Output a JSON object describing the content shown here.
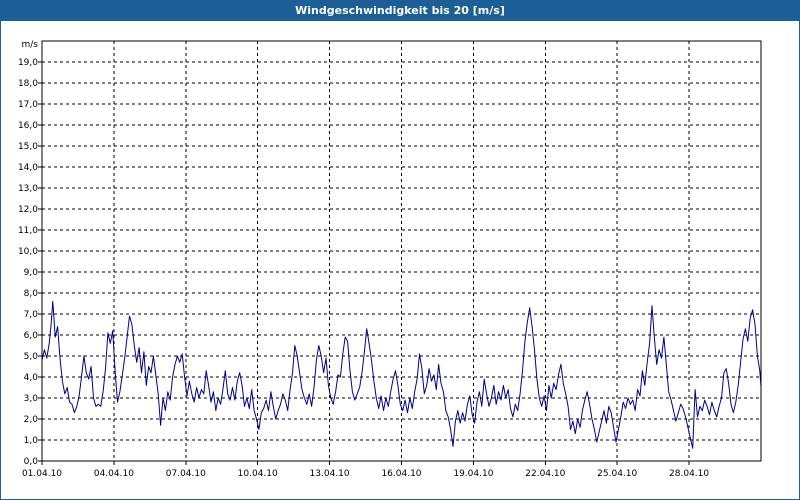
{
  "window": {
    "title": "Windgeschwindigkeit bis 20 [m/s]"
  },
  "colors": {
    "titlebar": "#1c5e96",
    "series": "#00008b",
    "grid": "#000000"
  },
  "chart_data": {
    "type": "line",
    "title": "Windgeschwindigkeit bis 20 [m/s]",
    "ylabel": "m/s",
    "ylim": [
      0,
      20
    ],
    "y_ticks": [
      "0,0",
      "1,0",
      "2,0",
      "3,0",
      "4,0",
      "5,0",
      "6,0",
      "7,0",
      "8,0",
      "9,0",
      "10,0",
      "11,0",
      "12,0",
      "13,0",
      "14,0",
      "15,0",
      "16,0",
      "17,0",
      "18,0",
      "19,0"
    ],
    "x_ticks": [
      "01.04.10",
      "04.04.10",
      "07.04.10",
      "10.04.10",
      "13.04.10",
      "16.04.10",
      "19.04.10",
      "22.04.10",
      "25.04.10",
      "28.04.10"
    ],
    "x_range": [
      "01.04.10 00:00",
      "01.05.10 00:00"
    ],
    "grid": true,
    "series": [
      {
        "x_unit": "days after 01.04.10 00:00",
        "values": [
          [
            0.0,
            4.8
          ],
          [
            0.1,
            5.3
          ],
          [
            0.2,
            4.9
          ],
          [
            0.3,
            5.6
          ],
          [
            0.38,
            6.5
          ],
          [
            0.45,
            7.6
          ],
          [
            0.55,
            5.9
          ],
          [
            0.65,
            6.4
          ],
          [
            0.75,
            4.9
          ],
          [
            0.85,
            3.8
          ],
          [
            0.95,
            3.2
          ],
          [
            1.05,
            3.5
          ],
          [
            1.15,
            2.8
          ],
          [
            1.25,
            2.7
          ],
          [
            1.35,
            2.3
          ],
          [
            1.45,
            2.6
          ],
          [
            1.55,
            3.1
          ],
          [
            1.65,
            4.0
          ],
          [
            1.75,
            5.0
          ],
          [
            1.85,
            4.2
          ],
          [
            1.95,
            3.9
          ],
          [
            2.05,
            4.5
          ],
          [
            2.15,
            3.0
          ],
          [
            2.25,
            2.6
          ],
          [
            2.35,
            2.7
          ],
          [
            2.45,
            2.6
          ],
          [
            2.55,
            3.3
          ],
          [
            2.65,
            4.4
          ],
          [
            2.75,
            6.1
          ],
          [
            2.85,
            5.6
          ],
          [
            2.95,
            6.2
          ],
          [
            3.05,
            4.3
          ],
          [
            3.15,
            2.8
          ],
          [
            3.25,
            3.3
          ],
          [
            3.35,
            4.1
          ],
          [
            3.45,
            4.9
          ],
          [
            3.55,
            5.9
          ],
          [
            3.65,
            6.9
          ],
          [
            3.75,
            6.5
          ],
          [
            3.85,
            5.5
          ],
          [
            3.95,
            4.7
          ],
          [
            4.05,
            5.4
          ],
          [
            4.15,
            4.2
          ],
          [
            4.25,
            5.2
          ],
          [
            4.35,
            3.6
          ],
          [
            4.45,
            4.5
          ],
          [
            4.55,
            4.2
          ],
          [
            4.65,
            5.0
          ],
          [
            4.75,
            4.1
          ],
          [
            4.85,
            3.2
          ],
          [
            4.95,
            1.7
          ],
          [
            5.05,
            3.0
          ],
          [
            5.15,
            2.4
          ],
          [
            5.25,
            3.3
          ],
          [
            5.35,
            2.9
          ],
          [
            5.45,
            4.0
          ],
          [
            5.55,
            4.6
          ],
          [
            5.65,
            5.0
          ],
          [
            5.75,
            4.7
          ],
          [
            5.85,
            5.1
          ],
          [
            5.95,
            4.0
          ],
          [
            6.05,
            3.1
          ],
          [
            6.15,
            3.8
          ],
          [
            6.25,
            3.2
          ],
          [
            6.35,
            2.8
          ],
          [
            6.45,
            3.5
          ],
          [
            6.55,
            3.0
          ],
          [
            6.65,
            3.4
          ],
          [
            6.75,
            3.2
          ],
          [
            6.85,
            4.3
          ],
          [
            6.95,
            3.6
          ],
          [
            7.05,
            2.8
          ],
          [
            7.15,
            3.3
          ],
          [
            7.25,
            2.4
          ],
          [
            7.35,
            3.0
          ],
          [
            7.45,
            2.7
          ],
          [
            7.55,
            3.4
          ],
          [
            7.65,
            4.3
          ],
          [
            7.75,
            3.2
          ],
          [
            7.85,
            2.9
          ],
          [
            7.95,
            3.5
          ],
          [
            8.05,
            2.9
          ],
          [
            8.15,
            3.8
          ],
          [
            8.25,
            4.2
          ],
          [
            8.35,
            3.6
          ],
          [
            8.45,
            2.6
          ],
          [
            8.55,
            3.0
          ],
          [
            8.65,
            2.5
          ],
          [
            8.75,
            3.4
          ],
          [
            8.85,
            2.4
          ],
          [
            8.95,
            2.0
          ],
          [
            9.05,
            1.5
          ],
          [
            9.15,
            2.3
          ],
          [
            9.25,
            2.5
          ],
          [
            9.35,
            2.9
          ],
          [
            9.45,
            2.4
          ],
          [
            9.55,
            3.3
          ],
          [
            9.65,
            2.6
          ],
          [
            9.75,
            2.0
          ],
          [
            9.85,
            2.4
          ],
          [
            9.95,
            2.7
          ],
          [
            10.05,
            3.2
          ],
          [
            10.15,
            2.9
          ],
          [
            10.25,
            2.4
          ],
          [
            10.35,
            3.4
          ],
          [
            10.45,
            4.2
          ],
          [
            10.55,
            5.5
          ],
          [
            10.65,
            5.0
          ],
          [
            10.75,
            4.2
          ],
          [
            10.85,
            3.4
          ],
          [
            10.95,
            3.0
          ],
          [
            11.05,
            2.7
          ],
          [
            11.15,
            3.2
          ],
          [
            11.25,
            2.6
          ],
          [
            11.35,
            3.5
          ],
          [
            11.45,
            4.8
          ],
          [
            11.55,
            5.5
          ],
          [
            11.65,
            5.0
          ],
          [
            11.75,
            4.2
          ],
          [
            11.85,
            4.9
          ],
          [
            11.95,
            3.6
          ],
          [
            12.05,
            3.0
          ],
          [
            12.15,
            2.7
          ],
          [
            12.25,
            3.3
          ],
          [
            12.35,
            4.1
          ],
          [
            12.45,
            4.0
          ],
          [
            12.55,
            5.1
          ],
          [
            12.65,
            5.9
          ],
          [
            12.75,
            5.7
          ],
          [
            12.85,
            4.3
          ],
          [
            12.95,
            3.3
          ],
          [
            13.05,
            2.9
          ],
          [
            13.15,
            3.2
          ],
          [
            13.25,
            3.5
          ],
          [
            13.35,
            4.2
          ],
          [
            13.45,
            5.2
          ],
          [
            13.55,
            6.3
          ],
          [
            13.65,
            5.6
          ],
          [
            13.75,
            4.8
          ],
          [
            13.85,
            3.8
          ],
          [
            13.95,
            3.0
          ],
          [
            14.05,
            2.5
          ],
          [
            14.15,
            3.1
          ],
          [
            14.25,
            2.4
          ],
          [
            14.35,
            3.0
          ],
          [
            14.45,
            2.6
          ],
          [
            14.55,
            3.3
          ],
          [
            14.65,
            3.9
          ],
          [
            14.75,
            4.3
          ],
          [
            14.85,
            3.6
          ],
          [
            14.95,
            2.7
          ],
          [
            15.05,
            2.4
          ],
          [
            15.15,
            2.9
          ],
          [
            15.25,
            2.3
          ],
          [
            15.35,
            3.0
          ],
          [
            15.45,
            2.5
          ],
          [
            15.55,
            3.3
          ],
          [
            15.65,
            3.9
          ],
          [
            15.75,
            5.1
          ],
          [
            15.85,
            4.4
          ],
          [
            15.95,
            3.2
          ],
          [
            16.05,
            3.6
          ],
          [
            16.15,
            4.4
          ],
          [
            16.25,
            3.8
          ],
          [
            16.35,
            4.1
          ],
          [
            16.45,
            3.4
          ],
          [
            16.55,
            4.6
          ],
          [
            16.65,
            3.7
          ],
          [
            16.75,
            3.3
          ],
          [
            16.85,
            2.4
          ],
          [
            16.95,
            2.1
          ],
          [
            17.05,
            1.5
          ],
          [
            17.15,
            0.7
          ],
          [
            17.25,
            1.9
          ],
          [
            17.35,
            2.4
          ],
          [
            17.45,
            1.8
          ],
          [
            17.55,
            2.3
          ],
          [
            17.65,
            1.9
          ],
          [
            17.75,
            2.7
          ],
          [
            17.85,
            3.1
          ],
          [
            17.95,
            2.2
          ],
          [
            18.05,
            1.8
          ],
          [
            18.15,
            2.8
          ],
          [
            18.25,
            3.3
          ],
          [
            18.35,
            2.6
          ],
          [
            18.45,
            3.9
          ],
          [
            18.55,
            3.2
          ],
          [
            18.65,
            2.6
          ],
          [
            18.75,
            3.0
          ],
          [
            18.85,
            3.6
          ],
          [
            18.95,
            2.7
          ],
          [
            19.05,
            3.3
          ],
          [
            19.15,
            2.9
          ],
          [
            19.25,
            3.6
          ],
          [
            19.35,
            3.0
          ],
          [
            19.45,
            3.4
          ],
          [
            19.55,
            2.5
          ],
          [
            19.65,
            2.1
          ],
          [
            19.75,
            2.7
          ],
          [
            19.85,
            2.4
          ],
          [
            19.95,
            3.2
          ],
          [
            20.05,
            4.3
          ],
          [
            20.15,
            5.7
          ],
          [
            20.25,
            6.6
          ],
          [
            20.35,
            7.3
          ],
          [
            20.45,
            6.4
          ],
          [
            20.55,
            5.3
          ],
          [
            20.65,
            3.9
          ],
          [
            20.75,
            3.0
          ],
          [
            20.85,
            2.6
          ],
          [
            20.95,
            3.1
          ],
          [
            21.05,
            2.4
          ],
          [
            21.15,
            3.6
          ],
          [
            21.25,
            3.0
          ],
          [
            21.35,
            3.7
          ],
          [
            21.45,
            3.4
          ],
          [
            21.55,
            4.1
          ],
          [
            21.65,
            4.6
          ],
          [
            21.75,
            3.7
          ],
          [
            21.85,
            3.2
          ],
          [
            21.95,
            2.6
          ],
          [
            22.05,
            1.5
          ],
          [
            22.15,
            1.9
          ],
          [
            22.25,
            1.3
          ],
          [
            22.35,
            2.0
          ],
          [
            22.45,
            1.6
          ],
          [
            22.55,
            2.4
          ],
          [
            22.65,
            2.9
          ],
          [
            22.75,
            3.3
          ],
          [
            22.85,
            2.7
          ],
          [
            22.95,
            2.0
          ],
          [
            23.05,
            1.5
          ],
          [
            23.15,
            0.9
          ],
          [
            23.25,
            1.4
          ],
          [
            23.35,
            1.9
          ],
          [
            23.45,
            2.4
          ],
          [
            23.55,
            1.8
          ],
          [
            23.65,
            2.6
          ],
          [
            23.75,
            2.3
          ],
          [
            23.85,
            1.6
          ],
          [
            23.95,
            0.9
          ],
          [
            24.05,
            1.5
          ],
          [
            24.15,
            2.1
          ],
          [
            24.25,
            2.8
          ],
          [
            24.35,
            2.5
          ],
          [
            24.45,
            3.0
          ],
          [
            24.55,
            2.7
          ],
          [
            24.65,
            2.9
          ],
          [
            24.75,
            2.4
          ],
          [
            24.85,
            3.4
          ],
          [
            24.95,
            3.1
          ],
          [
            25.05,
            4.3
          ],
          [
            25.15,
            3.6
          ],
          [
            25.25,
            4.7
          ],
          [
            25.35,
            5.6
          ],
          [
            25.45,
            7.4
          ],
          [
            25.55,
            5.9
          ],
          [
            25.65,
            4.6
          ],
          [
            25.75,
            5.3
          ],
          [
            25.85,
            4.9
          ],
          [
            25.95,
            5.9
          ],
          [
            26.05,
            4.6
          ],
          [
            26.15,
            3.3
          ],
          [
            26.25,
            2.9
          ],
          [
            26.35,
            2.4
          ],
          [
            26.45,
            1.9
          ],
          [
            26.55,
            2.3
          ],
          [
            26.65,
            2.7
          ],
          [
            26.75,
            2.5
          ],
          [
            26.85,
            2.1
          ],
          [
            26.95,
            1.6
          ],
          [
            27.05,
            1.1
          ],
          [
            27.15,
            0.6
          ],
          [
            27.25,
            3.4
          ],
          [
            27.35,
            2.1
          ],
          [
            27.45,
            2.6
          ],
          [
            27.55,
            2.4
          ],
          [
            27.65,
            2.9
          ],
          [
            27.75,
            2.6
          ],
          [
            27.85,
            2.2
          ],
          [
            27.95,
            2.8
          ],
          [
            28.05,
            2.4
          ],
          [
            28.15,
            2.1
          ],
          [
            28.25,
            2.6
          ],
          [
            28.35,
            3.0
          ],
          [
            28.45,
            4.2
          ],
          [
            28.55,
            4.4
          ],
          [
            28.65,
            3.7
          ],
          [
            28.75,
            2.7
          ],
          [
            28.85,
            2.3
          ],
          [
            28.95,
            2.8
          ],
          [
            29.05,
            3.6
          ],
          [
            29.15,
            4.7
          ],
          [
            29.25,
            5.8
          ],
          [
            29.35,
            6.3
          ],
          [
            29.45,
            5.7
          ],
          [
            29.55,
            6.8
          ],
          [
            29.65,
            7.2
          ],
          [
            29.75,
            6.5
          ],
          [
            29.85,
            5.0
          ],
          [
            29.95,
            4.3
          ],
          [
            30.0,
            3.5
          ]
        ]
      }
    ]
  }
}
